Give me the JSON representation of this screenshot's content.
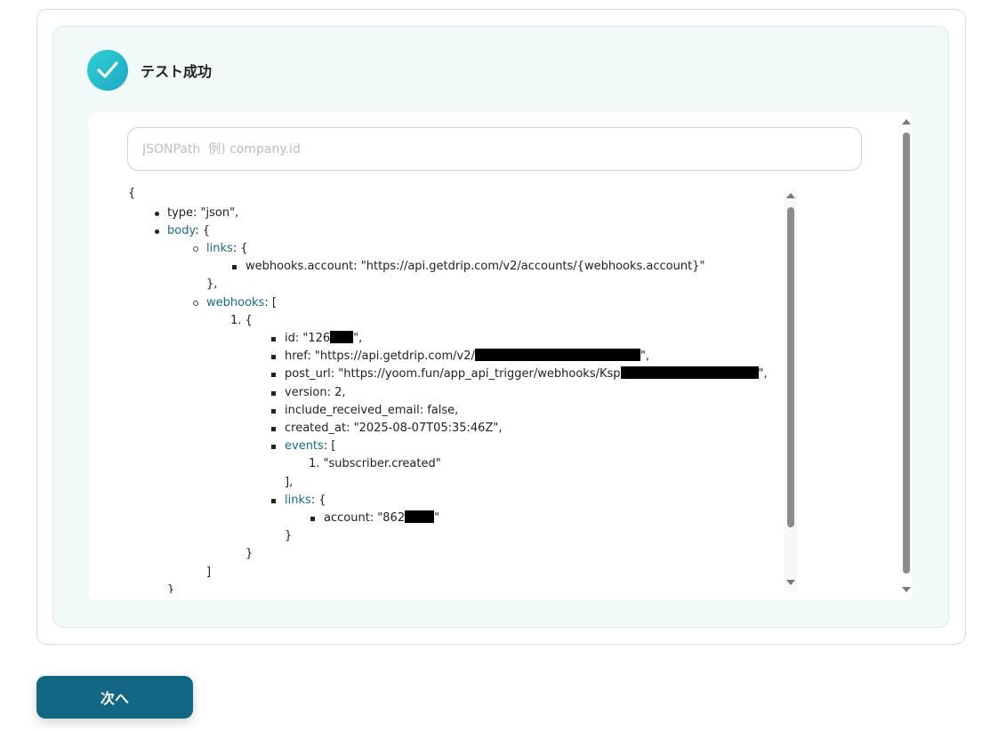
{
  "status": {
    "title": "テスト成功"
  },
  "search": {
    "placeholder": "JSONPath  例) company.id"
  },
  "tree": {
    "open_brace": "{",
    "type_line": "type: \"json\",",
    "body_key": "body",
    "body_suffix": ": {",
    "links_key": "links",
    "links_suffix": ": {",
    "webhooks_account": "webhooks.account: \"https://api.getdrip.com/v2/accounts/{webhooks.account}\"",
    "close_links": "},",
    "webhooks_key": "webhooks",
    "webhooks_suffix": ": [",
    "item1": "1. {",
    "id_prefix": "id: \"126",
    "id_suffix": "\",",
    "href_prefix": "href: \"https://api.getdrip.com/v2/",
    "href_suffix": "\",",
    "post_url_prefix": "post_url: \"https://yoom.fun/app_api_trigger/webhooks/Ksp",
    "post_url_suffix": "\",",
    "version": "version: 2,",
    "include_received_email": "include_received_email: false,",
    "created_at": "created_at: \"2025-08-07T05:35:46Z\",",
    "events_key": "events",
    "events_suffix": ": [",
    "event1": "1. \"subscriber.created\"",
    "close_events": "],",
    "inner_links_key": "links",
    "inner_links_suffix": ": {",
    "account_prefix": "account: \"862",
    "account_suffix": "\"",
    "close_inner_links": "}",
    "close_item": "}",
    "close_webhooks": "]",
    "close_body": "}"
  },
  "footer": {
    "next_label": "次へ"
  }
}
